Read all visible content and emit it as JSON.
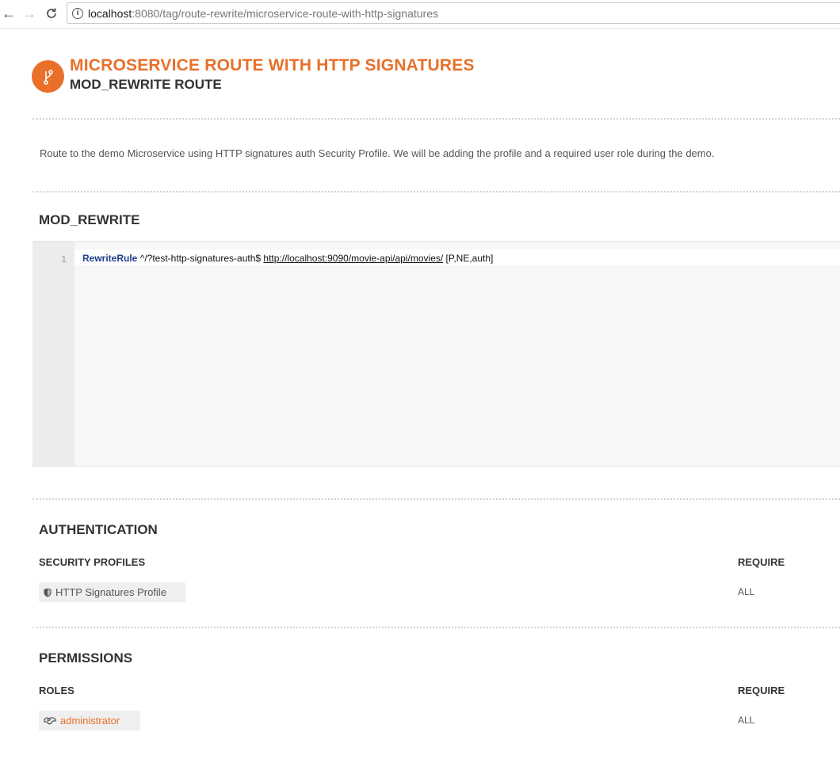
{
  "browser": {
    "url_host": "localhost",
    "url_path": ":8080/tag/route-rewrite/microservice-route-with-http-signatures"
  },
  "header": {
    "title": "MICROSERVICE ROUTE WITH HTTP SIGNATURES",
    "subtitle": "MOD_REWRITE ROUTE",
    "icon": "branch-icon",
    "accent_color": "#e8702a"
  },
  "description": "Route to the demo Microservice using HTTP signatures auth Security Profile. We will be adding the profile and a required user role during the demo.",
  "mod_rewrite": {
    "heading": "MOD_REWRITE",
    "line_number": "1",
    "code": {
      "keyword": "RewriteRule",
      "pattern": " ^/?test-http-signatures-auth$ ",
      "target": "http://localhost:9090/movie-api/api/movies/",
      "flags": " [P,NE,auth]"
    }
  },
  "authentication": {
    "heading": "AUTHENTICATION",
    "col_left": "SECURITY PROFILES",
    "col_right": "REQUIRE",
    "profile_label": "HTTP Signatures Profile",
    "profile_icon": "shield-icon",
    "require_value": "ALL"
  },
  "permissions": {
    "heading": "PERMISSIONS",
    "col_left": "ROLES",
    "col_right": "REQUIRE",
    "role_label": "administrator",
    "role_icon": "handshake-icon",
    "require_value": "ALL"
  }
}
